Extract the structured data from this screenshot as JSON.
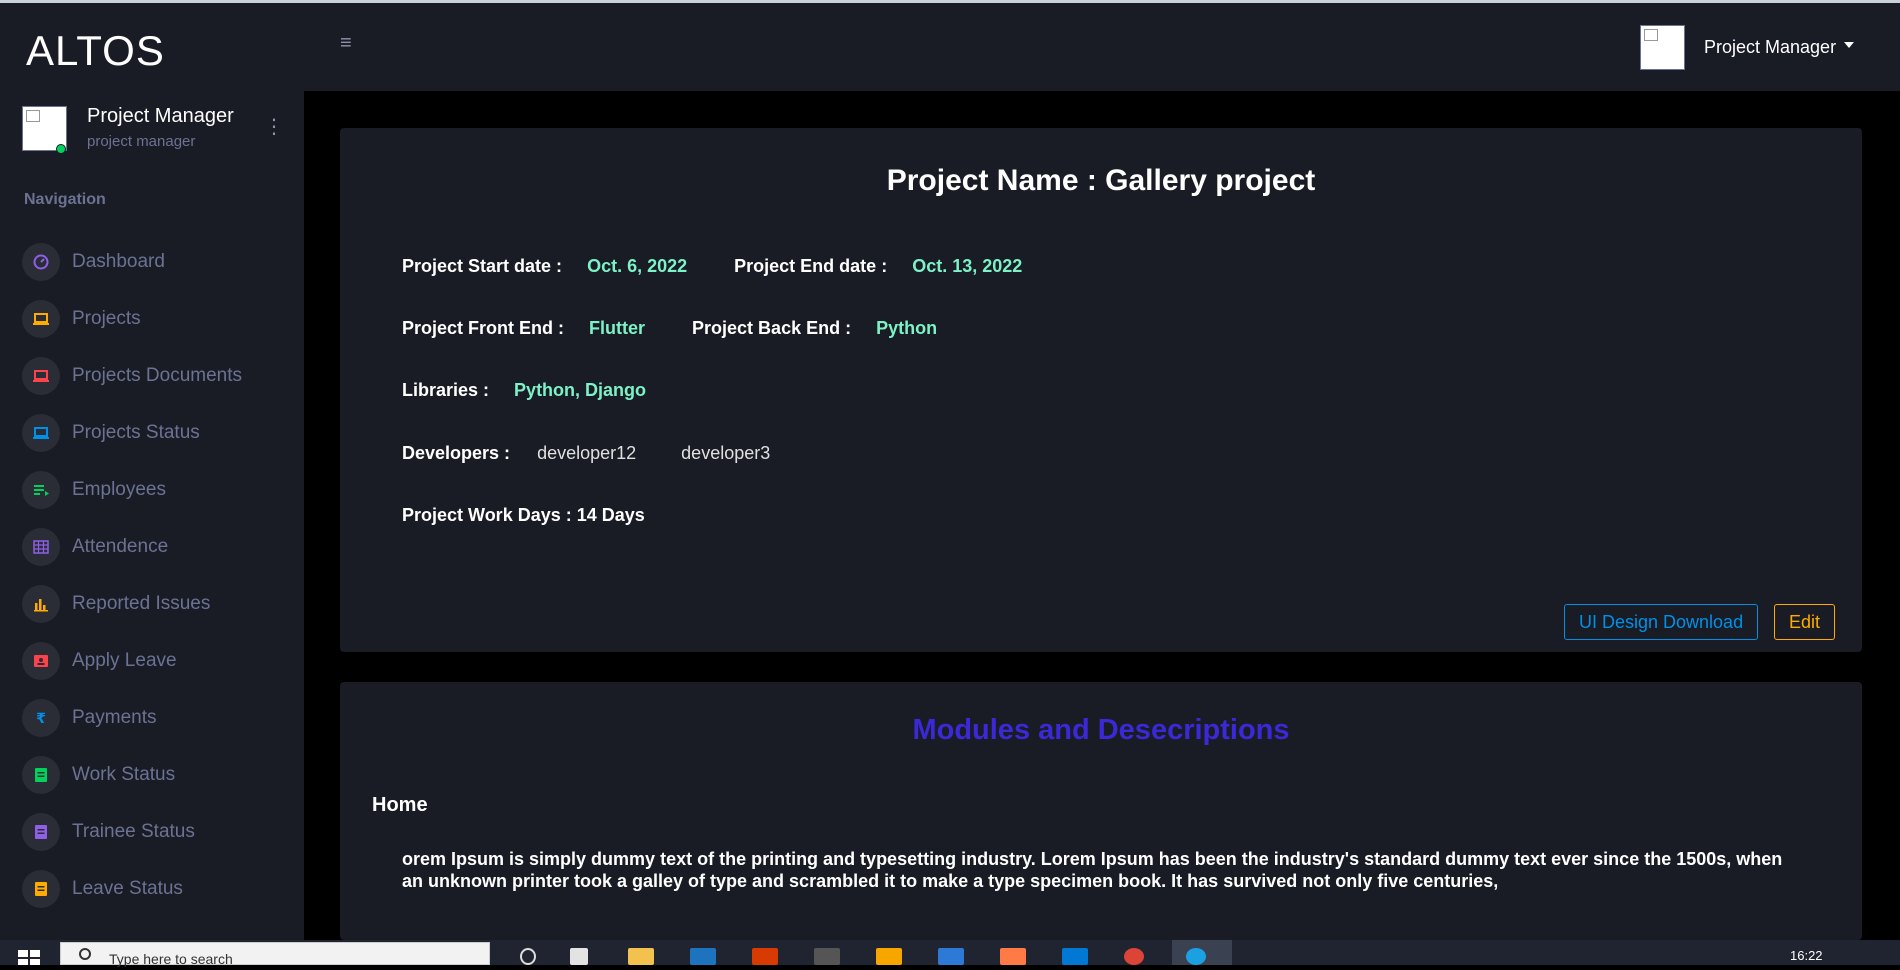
{
  "app": {
    "brand": "ALTOS"
  },
  "profile": {
    "name": "Project Manager",
    "role": "project manager"
  },
  "navigation": {
    "title": "Navigation",
    "items": [
      {
        "label": "Dashboard",
        "icon": "speedometer-icon",
        "color": "#8f5fe8"
      },
      {
        "label": "Projects",
        "icon": "laptop-icon",
        "color": "#ffab00"
      },
      {
        "label": "Projects Documents",
        "icon": "laptop-icon",
        "color": "#fc424a"
      },
      {
        "label": "Projects Status",
        "icon": "laptop-icon",
        "color": "#0090e7"
      },
      {
        "label": "Employees",
        "icon": "playlist-icon",
        "color": "#00d25b"
      },
      {
        "label": "Attendence",
        "icon": "table-icon",
        "color": "#8f5fe8"
      },
      {
        "label": "Reported Issues",
        "icon": "chart-bar-icon",
        "color": "#ffab00"
      },
      {
        "label": "Apply Leave",
        "icon": "contacts-icon",
        "color": "#fc424a"
      },
      {
        "label": "Payments",
        "icon": "rupee-icon",
        "color": "#0090e7"
      },
      {
        "label": "Work Status",
        "icon": "note-icon",
        "color": "#00d25b"
      },
      {
        "label": "Trainee Status",
        "icon": "note-icon",
        "color": "#8f5fe8"
      },
      {
        "label": "Leave Status",
        "icon": "note-icon",
        "color": "#ffab00"
      }
    ]
  },
  "topbar": {
    "user": "Project Manager"
  },
  "project": {
    "title": "Project Name : Gallery project",
    "start_label": "Project Start date :",
    "start_value": "Oct. 6, 2022",
    "end_label": "Project End date :",
    "end_value": "Oct. 13, 2022",
    "front_label": "Project Front End :",
    "front_value": "Flutter",
    "back_label": "Project Back End :",
    "back_value": "Python",
    "libraries_label": "Libraries :",
    "libraries_value": "Python, Django",
    "developers_label": "Developers :",
    "developers": [
      "developer12",
      "developer3"
    ],
    "workdays": "Project Work Days : 14 Days",
    "ui_button": "UI Design Download",
    "edit_button": "Edit"
  },
  "modules": {
    "title": "Modules and Desecriptions",
    "items": [
      {
        "name": "Home",
        "description": "orem Ipsum is simply dummy text of the printing and typesetting industry. Lorem Ipsum has been the industry's standard dummy text ever since the 1500s, when an unknown printer took a galley of type and scrambled it to make a type specimen book. It has survived not only five centuries,"
      }
    ]
  },
  "taskbar": {
    "search_placeholder": "Type here to search",
    "time": "16:22"
  }
}
